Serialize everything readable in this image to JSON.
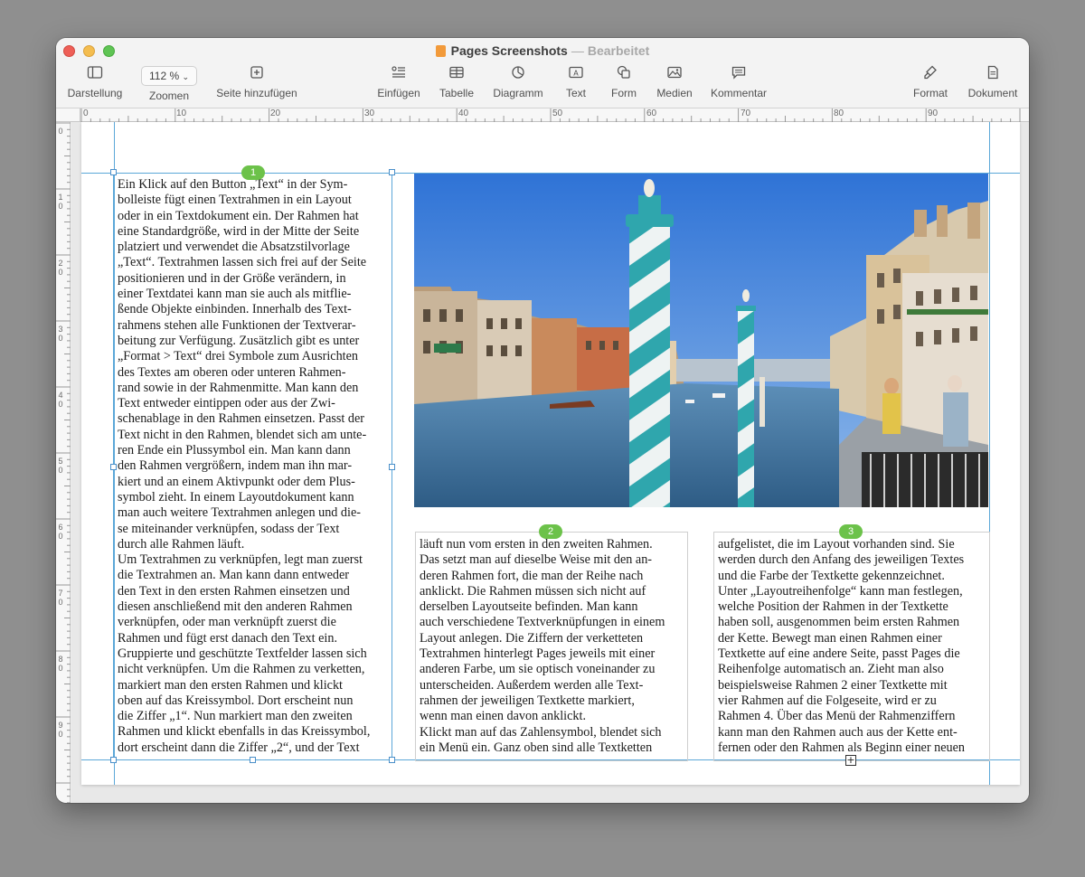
{
  "window": {
    "title": "Pages Screenshots",
    "separator": "—",
    "status": "Bearbeitet"
  },
  "toolbar": {
    "darstellung": "Darstellung",
    "zoom_value": "112 %",
    "zoomen": "Zoomen",
    "seite_hinzufuegen": "Seite hinzufügen",
    "einfuegen": "Einfügen",
    "tabelle": "Tabelle",
    "diagramm": "Diagramm",
    "text": "Text",
    "form": "Form",
    "medien": "Medien",
    "kommentar": "Kommentar",
    "format": "Format",
    "dokument": "Dokument"
  },
  "ruler": {
    "h_marks": [
      "0",
      "10",
      "20",
      "30",
      "40",
      "50",
      "60",
      "70",
      "80",
      "90"
    ],
    "v_marks": [
      "0",
      "1\n0",
      "2\n0",
      "3\n0",
      "4\n0",
      "5\n0",
      "6\n0",
      "7\n0",
      "8\n0",
      "9\n0"
    ]
  },
  "frames": {
    "badge1": "1",
    "badge2": "2",
    "badge3": "3",
    "col1": "Ein Klick auf den Button „Text“ in der Sym-\nbolleiste fügt einen Textrahmen in ein Layout\noder in ein Textdokument ein. Der Rahmen hat\neine Standardgröße, wird in der Mitte der Seite\nplatziert und verwendet die Absatzstilvorlage\n„Text“. Textrahmen lassen sich frei auf der Seite\npositionieren und in der Größe verändern, in\neiner Textdatei kann man sie auch als mitflie-\nßende Objekte einbinden. Innerhalb des Text-\nrahmens stehen alle Funktionen der Textverar-\nbeitung zur Verfügung. Zusätzlich gibt es unter\n„Format > Text“ drei Symbole zum Ausrichten\ndes Textes am oberen oder unteren Rahmen-\nrand sowie in der Rahmenmitte. Man kann den\nText entweder eintippen oder aus der Zwi-\nschenablage in den Rahmen einsetzen. Passt der\nText nicht in den Rahmen, blendet sich am unte-\nren Ende ein Plussymbol ein. Man kann dann\nden Rahmen vergrößern, indem man ihn mar-\nkiert und an einem Aktivpunkt oder dem Plus-\nsymbol zieht. In einem Layoutdokument kann\nman auch weitere Textrahmen anlegen und die-\nse miteinander verknüpfen, sodass der Text\ndurch alle Rahmen läuft.\nUm Textrahmen zu verknüpfen, legt man zuerst\ndie Textrahmen an. Man kann dann entweder\nden Text in den ersten Rahmen einsetzen und\ndiesen anschließend mit den anderen Rahmen\nverknüpfen, oder man verknüpft zuerst die\nRahmen und fügt erst danach den Text ein.\nGruppierte und geschützte Textfelder lassen sich\nnicht verknüpfen. Um die Rahmen zu verketten,\nmarkiert man den ersten Rahmen und klickt\noben auf das Kreissymbol. Dort erscheint nun\ndie Ziffer „1“. Nun markiert man den zweiten\nRahmen und klickt ebenfalls in das Kreissymbol,\ndort erscheint dann die Ziffer „2“, und der Text",
    "col2": "läuft nun vom ersten in den zweiten Rahmen.\nDas setzt man auf dieselbe Weise mit den an-\nderen Rahmen fort, die man der Reihe nach\nanklickt. Die Rahmen müssen sich nicht auf\nderselben Layoutseite befinden. Man kann\nauch verschiedene Textverknüpfungen in einem\nLayout anlegen. Die Ziffern der verketteten\nTextrahmen hinterlegt Pages jeweils mit einer\nanderen Farbe, um sie optisch voneinander zu\nunterscheiden. Außerdem werden alle Text-\nrahmen der jeweiligen Textkette markiert,\nwenn man einen davon anklickt.\nKlickt man auf das Zahlensymbol, blendet sich\nein Menü ein. Ganz oben sind alle Textketten",
    "col3": "aufgelistet, die im Layout vorhanden sind. Sie\nwerden durch den Anfang des jeweiligen Textes\nund die Farbe der Textkette gekennzeichnet.\nUnter „Layoutreihenfolge“ kann man festlegen,\nwelche Position der Rahmen in der Textkette\nhaben soll, ausgenommen beim ersten Rahmen\nder Kette. Bewegt man einen Rahmen einer\nTextkette auf eine andere Seite, passt Pages die\nReihenfolge automatisch an. Zieht man also\nbeispielsweise Rahmen 2 einer Textkette mit\nvier Rahmen auf die Folgeseite, wird er zu\nRahmen 4. Über das Menü der Rahmenziffern\nkann man den Rahmen auch aus der Kette ent-\nfernen oder den Rahmen als Beginn einer neuen",
    "overflow_symbol": "+"
  },
  "colors": {
    "badge": "#6cc24a",
    "guide": "#5ba7d8",
    "sky": "#4a90e2",
    "water": "#3e6f9a",
    "pole_teal": "#2fa6ad"
  },
  "icons": [
    "sidebar-icon",
    "chevron-down-icon",
    "add-page-icon",
    "insert-icon",
    "table-icon",
    "chart-icon",
    "text-box-icon",
    "shape-icon",
    "media-icon",
    "comment-icon",
    "format-brush-icon",
    "document-icon"
  ]
}
